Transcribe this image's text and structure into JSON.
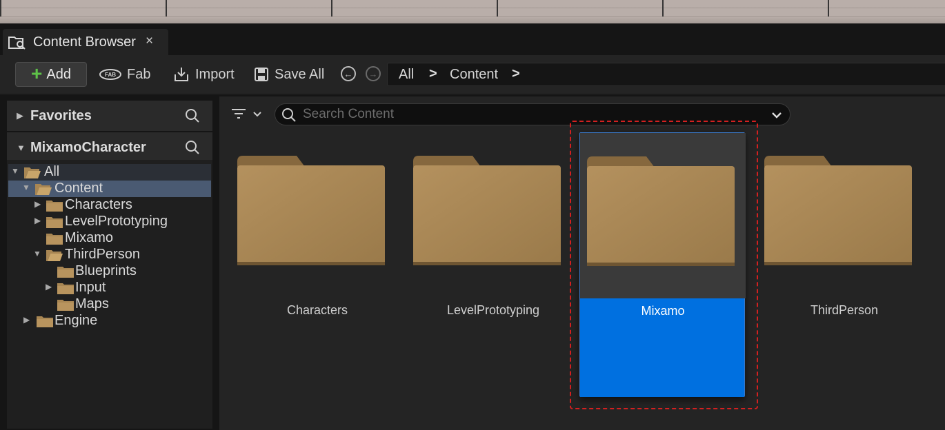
{
  "tab": {
    "title": "Content Browser",
    "close": "×",
    "icon": "content-browser-icon"
  },
  "toolbar": {
    "add_label": "Add",
    "fab_label": "Fab",
    "import_label": "Import",
    "saveall_label": "Save All",
    "back_icon": "arrow-left-circle-icon",
    "forward_icon": "arrow-right-circle-icon"
  },
  "breadcrumb": {
    "items": [
      "All",
      "Content"
    ],
    "separator": ">"
  },
  "favorites": {
    "label": "Favorites"
  },
  "project": {
    "label": "MixamoCharacter"
  },
  "tree": {
    "all": "All",
    "content": "Content",
    "characters": "Characters",
    "levelprototyping": "LevelPrototyping",
    "mixamo": "Mixamo",
    "thirdperson": "ThirdPerson",
    "blueprints": "Blueprints",
    "input": "Input",
    "maps": "Maps",
    "engine": "Engine"
  },
  "search": {
    "placeholder": "Search Content"
  },
  "assets": [
    {
      "name": "Characters"
    },
    {
      "name": "LevelPrototyping"
    },
    {
      "name": "Mixamo",
      "selected": true
    },
    {
      "name": "ThirdPerson"
    }
  ],
  "colors": {
    "accent_selected": "#0070e0",
    "folder": "#a88653",
    "add_plus": "#5ec248",
    "highlight_box": "#d42020"
  }
}
